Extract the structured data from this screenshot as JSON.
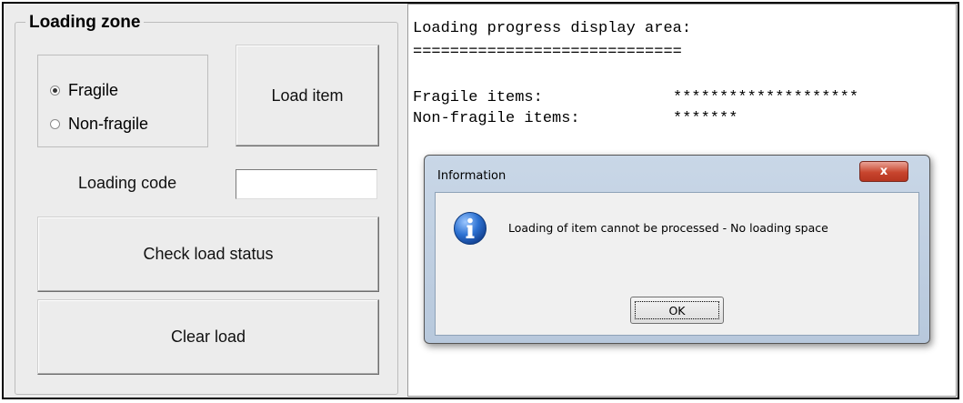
{
  "loading_zone": {
    "title": "Loading zone",
    "radio_options": [
      {
        "label": "Fragile",
        "checked": true
      },
      {
        "label": "Non-fragile",
        "checked": false
      }
    ],
    "load_item_label": "Load item",
    "loading_code_label": "Loading code",
    "loading_code_value": "",
    "check_status_label": "Check load status",
    "clear_load_label": "Clear load"
  },
  "display": {
    "heading": "Loading progress display area:",
    "underline": "=============================",
    "rows": [
      {
        "label": "Fragile items:",
        "stars": "********************"
      },
      {
        "label": "Non-fragile items:",
        "stars": "*******"
      }
    ]
  },
  "dialog": {
    "title": "Information",
    "close_glyph": "x",
    "message": "Loading of item cannot be processed - No loading space",
    "ok_label": "OK",
    "icon": "info-icon"
  },
  "colors": {
    "window_bg": "#ececec",
    "dialog_frame": "#b7c8dc",
    "close_red": "#c8452e",
    "info_blue": "#1f62c8"
  }
}
